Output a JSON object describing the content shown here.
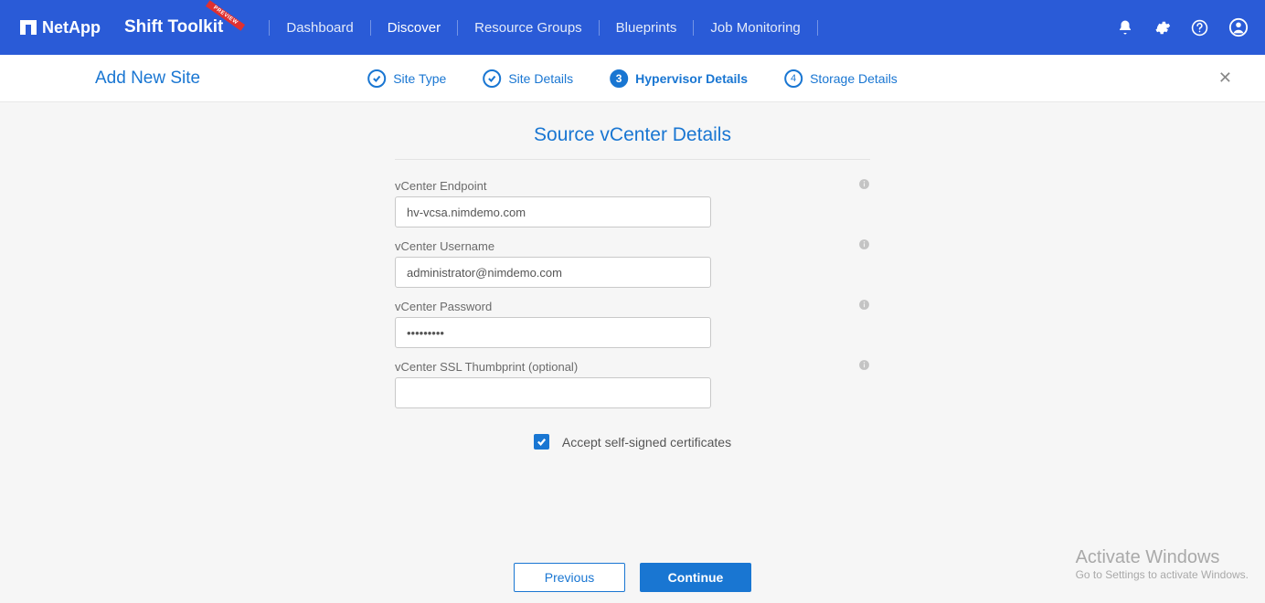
{
  "brand": "NetApp",
  "product_name": "Shift Toolkit",
  "ribbon": "PREVIEW",
  "nav": {
    "dashboard": "Dashboard",
    "discover": "Discover",
    "resource_groups": "Resource Groups",
    "blueprints": "Blueprints",
    "job_monitoring": "Job Monitoring"
  },
  "subbar": {
    "title": "Add New Site"
  },
  "steps": {
    "site_type": "Site Type",
    "site_details": "Site Details",
    "hypervisor_details": "Hypervisor Details",
    "storage_details": "Storage Details",
    "current_num": "3",
    "pending_num": "4"
  },
  "page_heading": "Source vCenter Details",
  "fields": {
    "endpoint": {
      "label": "vCenter Endpoint",
      "value": "hv-vcsa.nimdemo.com"
    },
    "username": {
      "label": "vCenter Username",
      "value": "administrator@nimdemo.com"
    },
    "password": {
      "label": "vCenter Password",
      "value": "•••••••••"
    },
    "thumbprint": {
      "label": "vCenter SSL Thumbprint (optional)",
      "value": ""
    }
  },
  "checkbox": {
    "label": "Accept self-signed certificates",
    "checked": true
  },
  "buttons": {
    "previous": "Previous",
    "continue": "Continue"
  },
  "watermark": {
    "line1": "Activate Windows",
    "line2": "Go to Settings to activate Windows."
  }
}
